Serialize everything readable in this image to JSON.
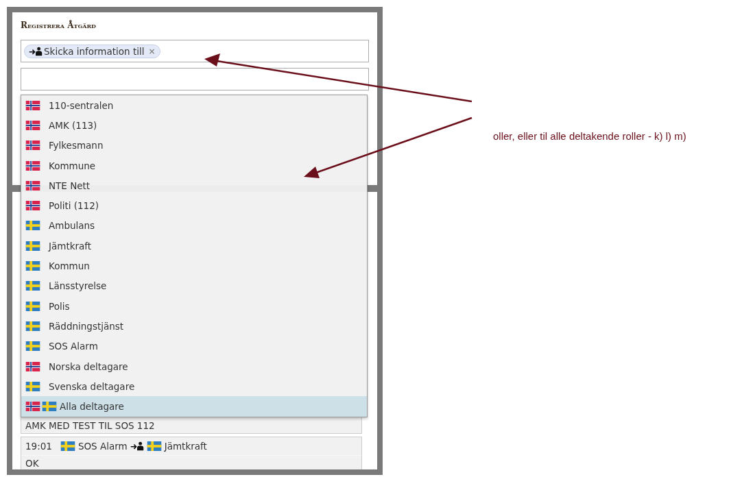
{
  "panel": {
    "title": "Registrera Åtgärd"
  },
  "action_field": {
    "tags": [
      {
        "label": "Skicka information till",
        "remove": "×"
      }
    ]
  },
  "dropdown": {
    "items": [
      {
        "label": "110-sentralen",
        "flags": [
          {
            "kind": "norway"
          }
        ],
        "selected": false
      },
      {
        "label": "AMK (113)",
        "flags": [
          {
            "kind": "norway"
          }
        ],
        "selected": false
      },
      {
        "label": "Fylkesmann",
        "flags": [
          {
            "kind": "norway"
          }
        ],
        "selected": false
      },
      {
        "label": "Kommune",
        "flags": [
          {
            "kind": "norway"
          }
        ],
        "selected": false
      },
      {
        "label": "NTE Nett",
        "flags": [
          {
            "kind": "norway"
          }
        ],
        "selected": false
      },
      {
        "label": "Politi (112)",
        "flags": [
          {
            "kind": "norway"
          }
        ],
        "selected": false
      },
      {
        "label": "Ambulans",
        "flags": [
          {
            "kind": "sweden"
          }
        ],
        "selected": false
      },
      {
        "label": "Jämtkraft",
        "flags": [
          {
            "kind": "sweden"
          }
        ],
        "selected": false
      },
      {
        "label": "Kommun",
        "flags": [
          {
            "kind": "sweden"
          }
        ],
        "selected": false
      },
      {
        "label": "Länsstyrelse",
        "flags": [
          {
            "kind": "sweden"
          }
        ],
        "selected": false
      },
      {
        "label": "Polis",
        "flags": [
          {
            "kind": "sweden"
          }
        ],
        "selected": false
      },
      {
        "label": "Räddningstjänst",
        "flags": [
          {
            "kind": "sweden"
          }
        ],
        "selected": false
      },
      {
        "label": "SOS Alarm",
        "flags": [
          {
            "kind": "sweden"
          }
        ],
        "selected": false
      },
      {
        "label": "Norska deltagare",
        "flags": [
          {
            "kind": "norway"
          }
        ],
        "selected": false
      },
      {
        "label": "Svenska deltagare",
        "flags": [
          {
            "kind": "sweden"
          }
        ],
        "selected": false
      },
      {
        "label": "Alla deltagare",
        "flags": [
          {
            "kind": "norway"
          },
          {
            "kind": "sweden"
          }
        ],
        "selected": true
      }
    ]
  },
  "log_entries": [
    {
      "message": "AMK MED TEST TIL SOS 112"
    },
    {
      "time": "19:01",
      "from": {
        "label": "SOS Alarm",
        "kind": "sweden"
      },
      "to": {
        "label": "Jämtkraft",
        "kind": "sweden"
      },
      "message": "OK"
    }
  ],
  "annotation": {
    "text": "oller, eller til alle deltakende roller - k) l) m)"
  }
}
